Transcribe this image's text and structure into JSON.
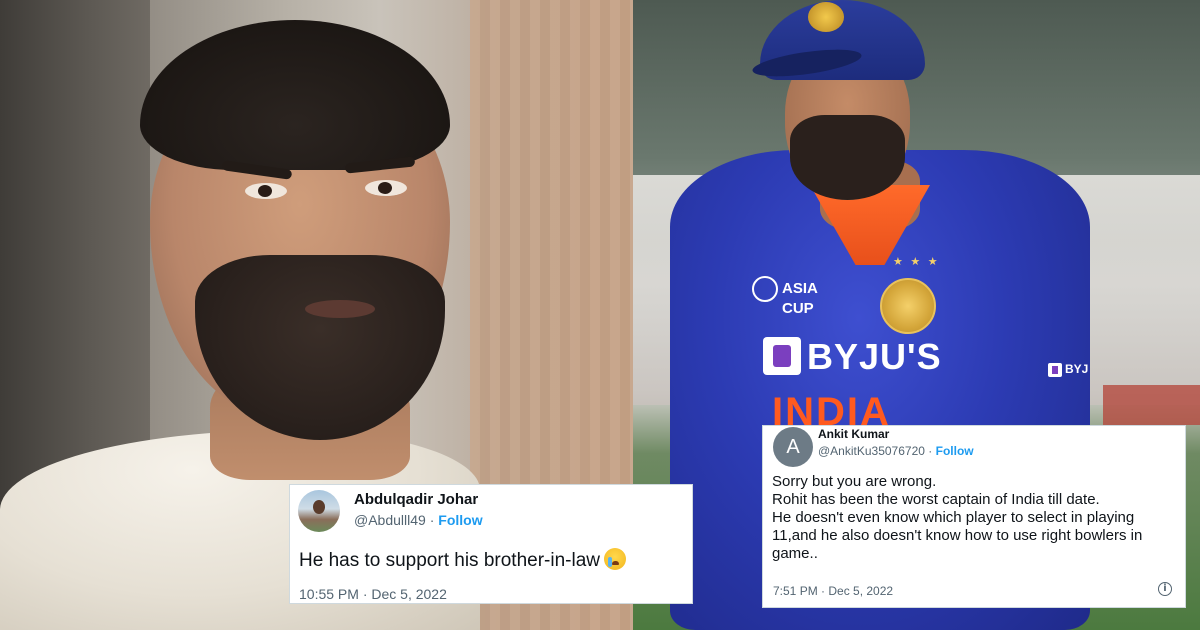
{
  "tweets": [
    {
      "name": "Abdulqadir Johar",
      "handle": "@Abdulll49",
      "separator": " · ",
      "follow_label": "Follow",
      "text": "He has to support his brother-in-law",
      "emoji_icon": "loudly-crying-face-icon",
      "timestamp": "10:55 PM · Dec 5, 2022"
    },
    {
      "name": "Ankit Kumar",
      "handle": "@AnkitKu35076720",
      "separator": " · ",
      "follow_label": "Follow",
      "avatar_initial": "A",
      "text_lines": [
        "Sorry but you are wrong.",
        "Rohit has been the worst captain of India till date.",
        "He doesn't even know which player to select in playing 11,and  he also doesn't know how to use right bowlers in game.."
      ],
      "timestamp": "7:51 PM · Dec 5, 2022",
      "info_icon": "info-icon"
    }
  ],
  "jersey": {
    "sponsor": "BYJU'S",
    "country": "INDIA",
    "tournament_line1": "ASIA",
    "tournament_line2": "CUP",
    "sleeve_sponsor": "BYJ"
  },
  "colors": {
    "link_blue": "#1d9bf0",
    "text_dark": "#0f1419",
    "text_muted": "#536471",
    "jersey_blue": "#2c3bb3",
    "jersey_orange": "#ff5a1f"
  }
}
